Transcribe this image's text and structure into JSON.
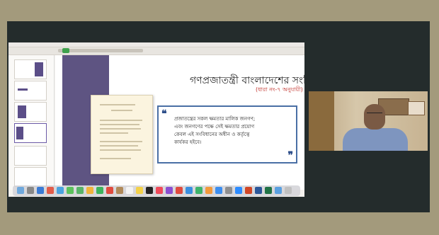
{
  "slide": {
    "title": "গণপ্রজাতন্ত্রী বাংলাদেশের সংবিধান",
    "subtitle": "(ধারা নং-৭ অনুযায়ী)",
    "quote_open": "❝",
    "quote_close": "❞",
    "quote_lines": [
      "প্রজাতন্ত্রের সকল ক্ষমতার মালিক জনগণ;",
      "এবং জনগণের পক্ষে সেই ক্ষমতার প্রয়োগ",
      "কেবল এই সংবিধানের অধীন ও কর্তৃত্বে",
      "কার্যকর হইবে।"
    ]
  },
  "colors": {
    "title": "#222222",
    "subtitle": "#c0302a",
    "quote_border": "#4a6fa5",
    "left_panel": "#5e5482"
  },
  "dock_icons": [
    "finder-icon",
    "launchpad-icon",
    "safari-icon",
    "chrome-icon",
    "mail-icon",
    "messages-icon",
    "maps-icon",
    "photos-icon",
    "facetime-icon",
    "calendar-icon",
    "contacts-icon",
    "reminders-icon",
    "notes-icon",
    "tv-icon",
    "music-icon",
    "podcasts-icon",
    "news-icon",
    "keynote-icon",
    "numbers-icon",
    "pages-icon",
    "app-store-icon",
    "settings-icon",
    "zoom-icon",
    "powerpoint-icon",
    "word-icon",
    "excel-icon",
    "downloads-icon",
    "trash-icon"
  ]
}
